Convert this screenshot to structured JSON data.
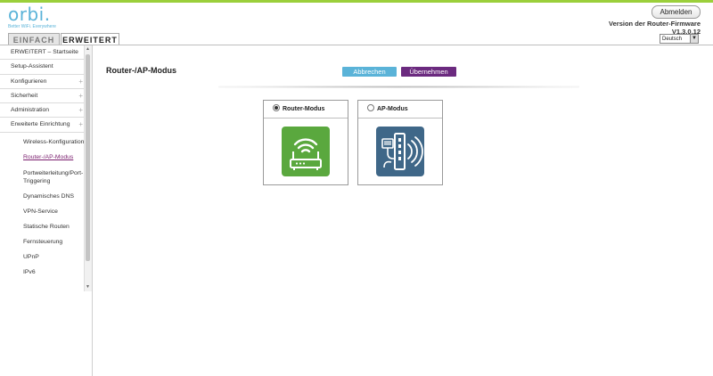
{
  "header": {
    "logo_text": "orbi.",
    "logo_tagline": "Better WiFi. Everywhere",
    "logout_label": "Abmelden",
    "firmware_label": "Version der Router-Firmware",
    "firmware_version": "V1.3.0.12",
    "language_selected": "Deutsch"
  },
  "tabs": {
    "basic": "EINFACH",
    "advanced": "ERWEITERT"
  },
  "sidebar": {
    "items": [
      {
        "label": "ERWEITERT – Startseite",
        "expandable": false
      },
      {
        "label": "Setup-Assistent",
        "expandable": false
      },
      {
        "label": "Konfigurieren",
        "expandable": true
      },
      {
        "label": "Sicherheit",
        "expandable": true
      },
      {
        "label": "Administration",
        "expandable": true
      },
      {
        "label": "Erweiterte Einrichtung",
        "expandable": true
      }
    ],
    "plus_symbol": "+",
    "subitems": [
      {
        "label": "Wireless-Konfiguration",
        "active": false
      },
      {
        "label": "Router-/AP-Modus",
        "active": true
      },
      {
        "label": "Portweiterleitung/Port-Triggering",
        "active": false
      },
      {
        "label": "Dynamisches DNS",
        "active": false
      },
      {
        "label": "VPN-Service",
        "active": false
      },
      {
        "label": "Statische Routen",
        "active": false
      },
      {
        "label": "Fernsteuerung",
        "active": false
      },
      {
        "label": "UPnP",
        "active": false
      },
      {
        "label": "IPv6",
        "active": false
      }
    ]
  },
  "main": {
    "title": "Router-/AP-Modus",
    "cancel_label": "Abbrechen",
    "apply_label": "Übernehmen",
    "modes": [
      {
        "label": "Router-Modus",
        "selected": true,
        "icon": "router-icon",
        "color": "#5aa83e"
      },
      {
        "label": "AP-Modus",
        "selected": false,
        "icon": "access-point-icon",
        "color": "#3f6788"
      }
    ]
  },
  "colors": {
    "accent_blue": "#5ab3d8",
    "accent_purple": "#6b2a7f",
    "brand_green": "#9bcf3b"
  }
}
